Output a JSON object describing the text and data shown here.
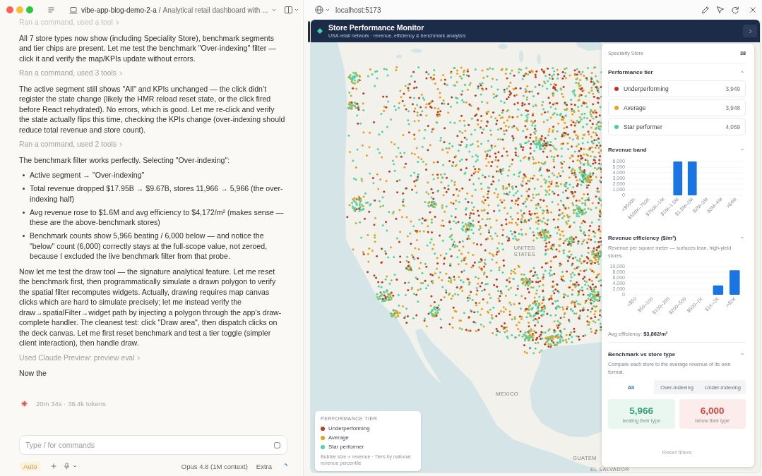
{
  "chat": {
    "project": "vibe-app-blog-demo-2-a",
    "separator": "/",
    "task": "Analytical retail dashboard with ...",
    "messages": [
      {
        "kind": "tool",
        "text": "Ran a command, used a tool"
      },
      {
        "kind": "text",
        "text": "All 7 store types now show (including Speciality Store), benchmark segments and tier chips are present. Let me test the benchmark \"Over-indexing\" filter — click it and verify the map/KPIs update without errors."
      },
      {
        "kind": "tool",
        "text": "Ran a command, used 3 tools"
      },
      {
        "kind": "text",
        "text": "The active segment still shows \"All\" and KPIs unchanged — the click didn’t register the state change (likely the HMR reload reset state, or the click fired before React rehydrated). No errors, which is good. Let me re-click and verify the state actually flips this time, checking the KPIs change (over-indexing should reduce total revenue and store count)."
      },
      {
        "kind": "tool",
        "text": "Ran a command, used 2 tools"
      },
      {
        "kind": "text",
        "text": "The benchmark filter works perfectly. Selecting \"Over-indexing\":"
      },
      {
        "kind": "list",
        "items": [
          "Active segment → \"Over-indexing\"",
          "Total revenue dropped $17.95B → $9.67B, stores 11,966 → 5,966 (the over-indexing half)",
          "Avg revenue rose to $1.6M and avg efficiency to $4,172/m² (makes sense — these are the above-benchmark stores)",
          "Benchmark counts show 5,966 beating / 6,000 below — and notice the \"below\" count (6,000) correctly stays at the full-scope value, not zeroed, because I excluded the live benchmark filter from that probe."
        ]
      },
      {
        "kind": "text",
        "text": "Now let me test the draw tool — the signature analytical feature. Let me reset the benchmark first, then programmatically simulate a drawn polygon to verify the spatial filter recomputes widgets. Actually, drawing requires map canvas clicks which are hard to simulate precisely; let me instead verify the draw→spatialFilter→widget path by injecting a polygon through the app's draw-complete handler. The cleanest test: click \"Draw area\", then dispatch clicks on the deck canvas. Let me first reset benchmark and test a tier toggle (simpler client interaction), then handle draw."
      },
      {
        "kind": "tool",
        "text": "Used Claude Preview: preview eval"
      },
      {
        "kind": "text",
        "text": "Now the"
      }
    ],
    "status": "20m 34s · 36.4k tokens",
    "composer": {
      "placeholder": "Type / for commands"
    },
    "mode": "Auto",
    "model": "Opus 4.8 (1M context)",
    "effort": "Extra"
  },
  "preview": {
    "url": "localhost:5173",
    "app": {
      "title": "Store Performance Monitor",
      "subtitle": "USA retail network · revenue, efficiency & benchmark analytics"
    },
    "map_labels": [
      "UNITED STATES",
      "MEXICO",
      "GUATEM",
      "EL SALVADOR"
    ],
    "legend": {
      "title": "PERFORMANCE TIER",
      "items": [
        {
          "label": "Underperforming",
          "color": "#b83c1f"
        },
        {
          "label": "Average",
          "color": "#e3a21c"
        },
        {
          "label": "Star performer",
          "color": "#4fd3a2"
        }
      ],
      "note": "Bubble size ∝ revenue · Tiers by national revenue percentile"
    },
    "panel": {
      "store_types": [
        {
          "label": "Speciality Store",
          "count": "38"
        }
      ],
      "sections": [
        {
          "kind": "tiers",
          "title": "Performance tier",
          "items": [
            {
              "label": "Underperforming",
              "count": "3,949",
              "color": "#c8302b"
            },
            {
              "label": "Average",
              "count": "3,948",
              "color": "#e6a41c"
            },
            {
              "label": "Star performer",
              "count": "4,069",
              "color": "#46d39b"
            }
          ]
        },
        {
          "kind": "chart",
          "title": "Revenue band",
          "chart_data": {
            "type": "bar",
            "grid": true,
            "categories": [
              "<$500K",
              "$500K–750K",
              "$750K–1M",
              "$1M–1.5M",
              "$1.5M–2M",
              "$2M–3M",
              "$3M–4M",
              ">$4M"
            ],
            "values": [
              0,
              0,
              0,
              6000,
              6000,
              0,
              0,
              0
            ],
            "ylim": [
              0,
              6000
            ],
            "yticks": [
              0,
              {
                "value": 1000,
                "label": "1,000"
              },
              {
                "value": 2000,
                "label": "2,000"
              },
              {
                "value": 3000,
                "label": "3,000"
              },
              {
                "value": 4000,
                "label": "4,000"
              },
              {
                "value": 5000,
                "label": "5,000"
              },
              {
                "value": 6000,
                "label": "6,000"
              }
            ]
          }
        },
        {
          "kind": "chart",
          "title": "Revenue efficiency ($/m²)",
          "description": "Revenue per square meter — surfaces lean, high-yield stores.",
          "chart_data": {
            "type": "bar",
            "grid": true,
            "categories": [
              "<$50",
              "$50–100",
              "$100–200",
              "$200–500",
              "$500–1K",
              "$1K–2K",
              ">$2K"
            ],
            "values": [
              0,
              0,
              0,
              0,
              0,
              3300,
              8700
            ],
            "ylim": [
              0,
              10000
            ],
            "yticks": [
              0,
              {
                "value": 2000,
                "label": "2,000"
              },
              {
                "value": 4000,
                "label": "4,000"
              },
              {
                "value": 6000,
                "label": "6,000"
              },
              {
                "value": 8000,
                "label": "8,000"
              },
              {
                "value": 10000,
                "label": "10,000"
              }
            ]
          },
          "summary": "Avg efficiency: **$3,862/m²**"
        },
        {
          "kind": "benchmark",
          "title": "Benchmark vs store type",
          "description": "Compare each store to the average revenue of its own format.",
          "segments": [
            {
              "label": "All",
              "selected": true
            },
            {
              "label": "Over-indexing",
              "selected": false
            },
            {
              "label": "Under-indexing",
              "selected": false
            }
          ],
          "stats": [
            {
              "kind": "beating",
              "value": "5,966",
              "label": "beating their type"
            },
            {
              "kind": "below",
              "value": "6,000",
              "label": "below their type"
            }
          ]
        }
      ],
      "reset": "Reset filters"
    }
  }
}
